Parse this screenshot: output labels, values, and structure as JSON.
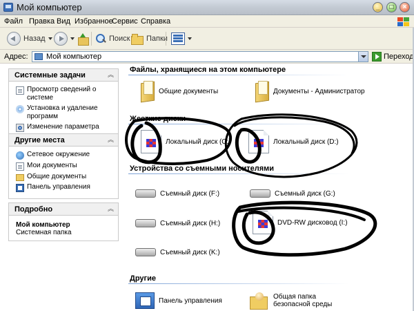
{
  "window": {
    "title": "Мой компьютер"
  },
  "menu": [
    "Файл",
    "Правка",
    "Вид",
    "Избранное",
    "Сервис",
    "Справка"
  ],
  "toolbar": {
    "back": "Назад",
    "search": "Поиск",
    "folders": "Папки"
  },
  "address": {
    "label": "Адрес:",
    "value": "Мой компьютер",
    "go": "Переход"
  },
  "tasks_panel": {
    "title": "Системные задачи",
    "items": [
      "Просмотр сведений о системе",
      "Установка и удаление программ",
      "Изменение параметра"
    ]
  },
  "places_panel": {
    "title": "Другие места",
    "items": [
      "Сетевое окружение",
      "Мои документы",
      "Общие документы",
      "Панель управления"
    ]
  },
  "details_panel": {
    "title": "Подробно",
    "name": "Мой компьютер",
    "type": "Системная папка"
  },
  "groups": {
    "files": {
      "title": "Файлы, хранящиеся на этом компьютере",
      "items": [
        "Общие документы",
        "Документы - Администратор"
      ]
    },
    "hard_disks": {
      "title": "Жесткие диски",
      "items": [
        "Локальный диск (C:)",
        "Локальный диск (D:)"
      ]
    },
    "removable": {
      "title": "Устройства со съемными носителями",
      "items": [
        "Съемный диск (F:)",
        "Съемный диск (G:)",
        "Съемный диск (H:)",
        "DVD-RW дисковод (I:)",
        "Съемный диск (K:)"
      ]
    },
    "other": {
      "title": "Другие",
      "items": [
        "Панель управления",
        "Общая папка безопасной среды"
      ]
    }
  }
}
